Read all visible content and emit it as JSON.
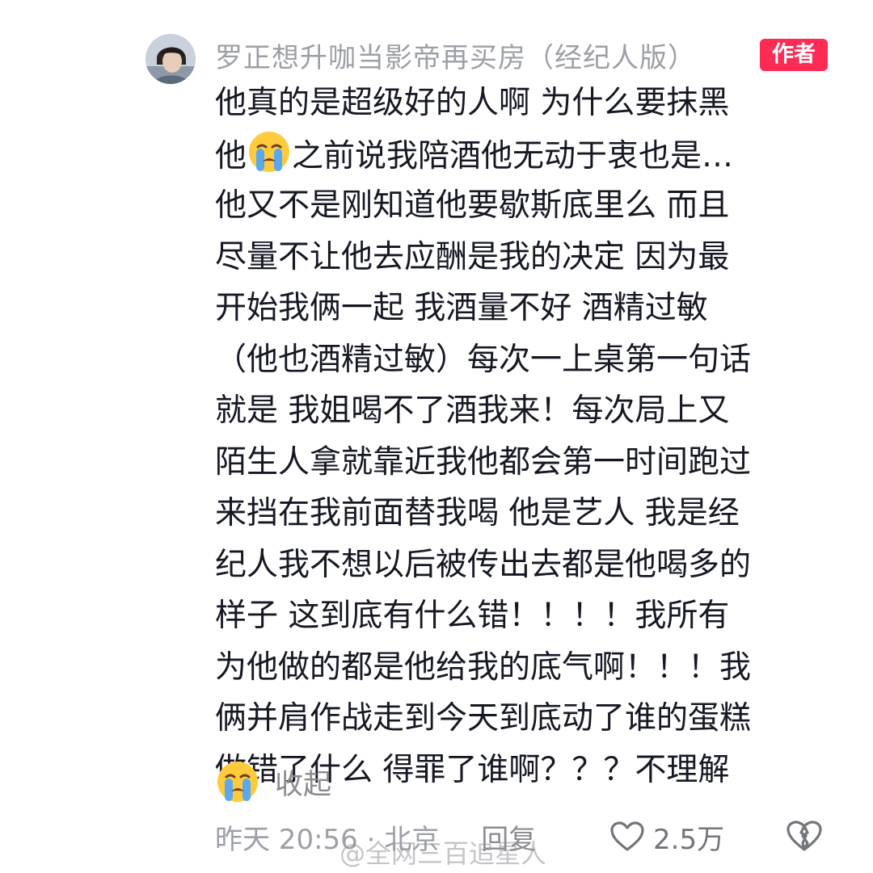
{
  "comment": {
    "username": "罗正想升咖当影帝再买房（经纪人版）",
    "author_badge": "作者",
    "lines": [
      {
        "pre": "他真的是超级好的人啊 为什么要抹黑"
      },
      {
        "pre": "他",
        "emoji": "loudly-crying-emoji",
        "post": "之前说我陪酒他无动于衷也是…"
      },
      {
        "pre": "他又不是刚知道他要歇斯底里么 而且"
      },
      {
        "pre": "尽量不让他去应酬是我的决定 因为最"
      },
      {
        "pre": "开始我俩一起 我酒量不好 酒精过敏"
      },
      {
        "pre": "（他也酒精过敏）每次一上桌第一句话"
      },
      {
        "pre": "就是 我姐喝不了酒我来！每次局上又"
      },
      {
        "pre": "陌生人拿就靠近我他都会第一时间跑过"
      },
      {
        "pre": "来挡在我前面替我喝 他是艺人 我是经"
      },
      {
        "pre": "纪人我不想以后被传出去都是他喝多的"
      },
      {
        "pre": "样子 这到底有什么错！！！！我所有"
      },
      {
        "pre": "为他做的都是他给我的底气啊！！！我"
      },
      {
        "pre": "俩并肩作战走到今天到底动了谁的蛋糕"
      },
      {
        "pre": "做错了什么 得罪了谁啊？？？不理解"
      }
    ],
    "collapse_label": "收起",
    "time_location": "昨天 20:56 · 北京",
    "reply_label": "回复",
    "like_count": "2.5万",
    "watermark": "@全网三百追星人"
  },
  "colors": {
    "badge": "#fe2c55",
    "text": "#161823",
    "meta": "#9c9fa6"
  }
}
